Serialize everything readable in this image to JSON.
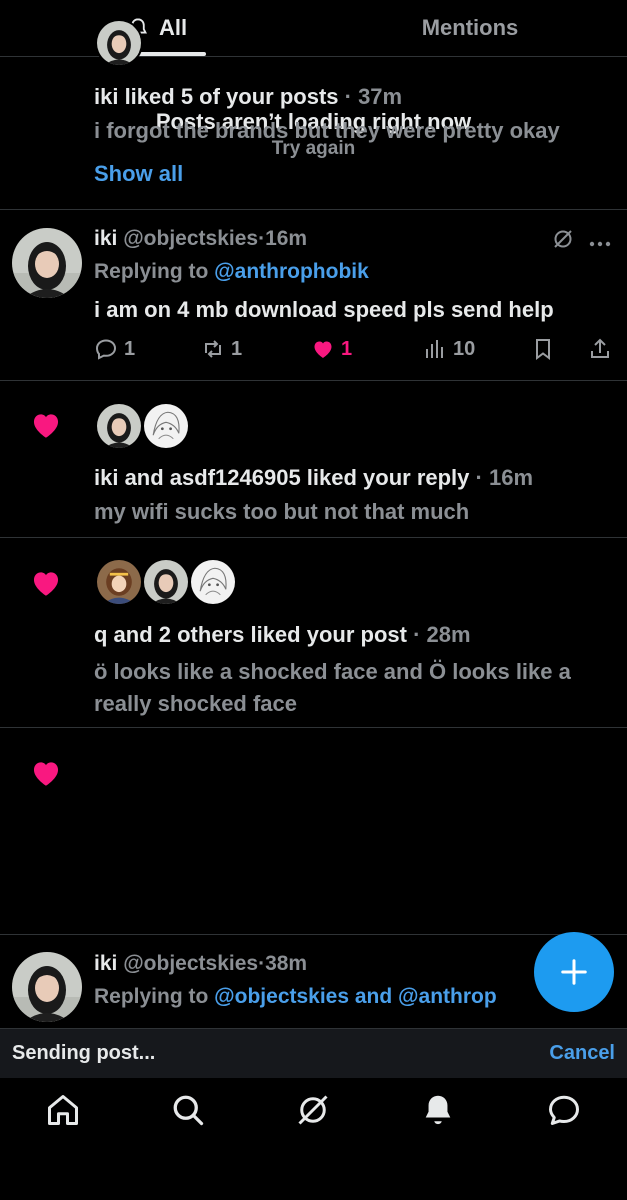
{
  "tabs": {
    "all": "All",
    "mentions": "Mentions"
  },
  "error": {
    "title": "Posts aren’t loading right now",
    "retry": "Try again"
  },
  "post1": {
    "display_name": "iki",
    "handle": "@objectskies",
    "sep": "·",
    "time": "16m",
    "replying_prefix": "Replying to ",
    "replying_to": "@anthrophobik",
    "text": "i am on 4 mb download speed pls send help",
    "replies": "1",
    "reposts": "1",
    "likes": "1",
    "views": "10"
  },
  "notif1": {
    "title": "iki and asdf1246905 liked your reply",
    "time": " · 16m",
    "sub": "my wifi sucks too but not that much"
  },
  "notif2": {
    "title": "q and 2 others liked your post",
    "time": " · 28m",
    "sub": "ö looks like a shocked face and Ö looks like a really shocked face"
  },
  "notif3": {
    "title": "iki liked 5 of your posts",
    "time": " · 37m",
    "sub": "i forgot the brands but they were pretty okay",
    "show_all": "Show all"
  },
  "post2": {
    "display_name": "iki",
    "handle": "@objectskies",
    "sep": "·",
    "time": "38m",
    "replying_prefix": "Replying to ",
    "replying_to": "@objectskies and @anthrop"
  },
  "sending": {
    "text": "Sending post...",
    "cancel": "Cancel"
  },
  "colors": {
    "accent": "#1d9bf0",
    "link": "#4a9fea",
    "like": "#f91880",
    "bg": "#000000"
  },
  "icons": {
    "tab_all": "bell-icon",
    "fab": "plus-icon",
    "nav": [
      "home-icon",
      "search-icon",
      "grok-icon",
      "notifications-icon",
      "messages-icon"
    ]
  }
}
